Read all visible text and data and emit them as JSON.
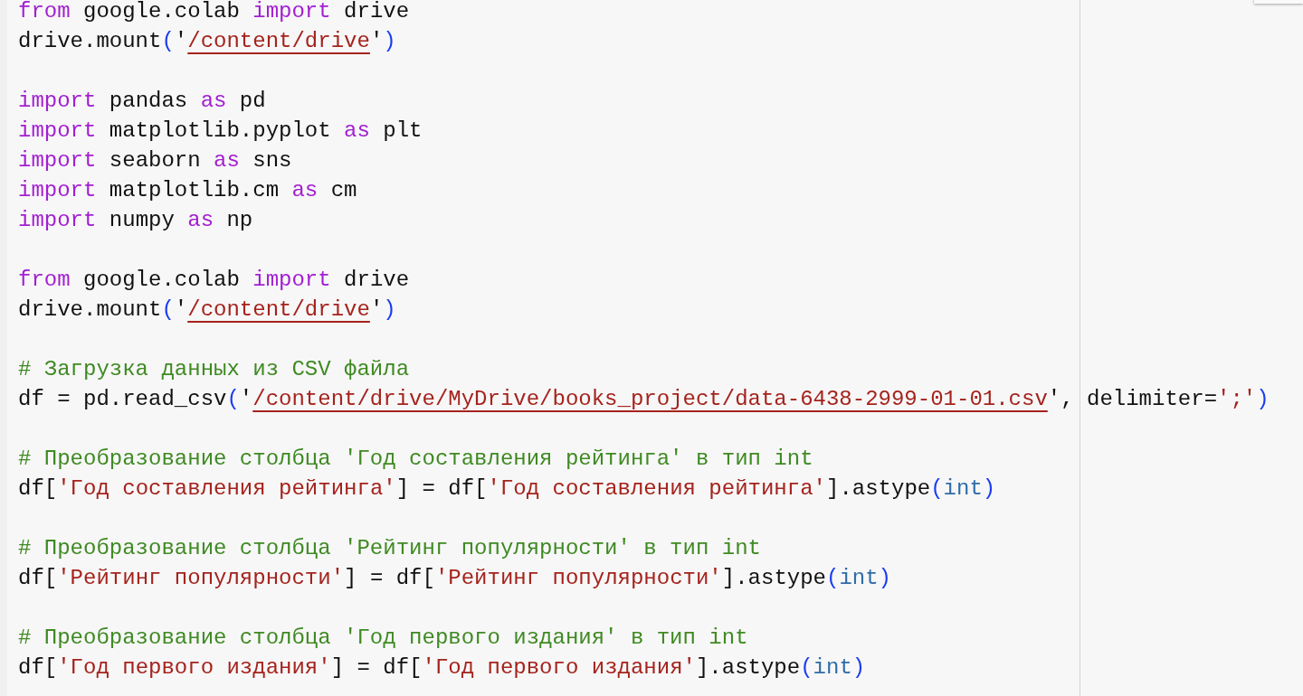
{
  "editor": {
    "blocks": [
      [
        {
          "tokens": [
            {
              "kind": "keyword",
              "text": "from"
            },
            {
              "kind": "plain",
              "text": " google.colab "
            },
            {
              "kind": "keyword",
              "text": "import"
            },
            {
              "kind": "plain",
              "text": " drive"
            }
          ]
        },
        {
          "tokens": [
            {
              "kind": "plain",
              "text": "drive.mount"
            },
            {
              "kind": "paren",
              "text": "("
            },
            {
              "kind": "plain",
              "text": "'"
            },
            {
              "kind": "path",
              "text": "/content/drive"
            },
            {
              "kind": "plain",
              "text": "'"
            },
            {
              "kind": "paren",
              "text": ")"
            }
          ]
        }
      ],
      [
        {
          "tokens": [
            {
              "kind": "keyword",
              "text": "import"
            },
            {
              "kind": "plain",
              "text": " pandas "
            },
            {
              "kind": "keyword",
              "text": "as"
            },
            {
              "kind": "plain",
              "text": " pd"
            }
          ]
        },
        {
          "tokens": [
            {
              "kind": "keyword",
              "text": "import"
            },
            {
              "kind": "plain",
              "text": " matplotlib.pyplot "
            },
            {
              "kind": "keyword",
              "text": "as"
            },
            {
              "kind": "plain",
              "text": " plt"
            }
          ]
        },
        {
          "tokens": [
            {
              "kind": "keyword",
              "text": "import"
            },
            {
              "kind": "plain",
              "text": " seaborn "
            },
            {
              "kind": "keyword",
              "text": "as"
            },
            {
              "kind": "plain",
              "text": " sns"
            }
          ]
        },
        {
          "tokens": [
            {
              "kind": "keyword",
              "text": "import"
            },
            {
              "kind": "plain",
              "text": " matplotlib.cm "
            },
            {
              "kind": "keyword",
              "text": "as"
            },
            {
              "kind": "plain",
              "text": " cm"
            }
          ]
        },
        {
          "tokens": [
            {
              "kind": "keyword",
              "text": "import"
            },
            {
              "kind": "plain",
              "text": " numpy "
            },
            {
              "kind": "keyword",
              "text": "as"
            },
            {
              "kind": "plain",
              "text": " np"
            }
          ]
        }
      ],
      [
        {
          "tokens": [
            {
              "kind": "keyword",
              "text": "from"
            },
            {
              "kind": "plain",
              "text": " google.colab "
            },
            {
              "kind": "keyword",
              "text": "import"
            },
            {
              "kind": "plain",
              "text": " drive"
            }
          ]
        },
        {
          "tokens": [
            {
              "kind": "plain",
              "text": "drive.mount"
            },
            {
              "kind": "paren",
              "text": "("
            },
            {
              "kind": "plain",
              "text": "'"
            },
            {
              "kind": "path",
              "text": "/content/drive"
            },
            {
              "kind": "plain",
              "text": "'"
            },
            {
              "kind": "paren",
              "text": ")"
            }
          ]
        }
      ],
      [
        {
          "tokens": [
            {
              "kind": "comment",
              "text": "# Загрузка данных из CSV файла"
            }
          ]
        },
        {
          "tokens": [
            {
              "kind": "plain",
              "text": "df = pd.read_csv"
            },
            {
              "kind": "paren",
              "text": "("
            },
            {
              "kind": "plain",
              "text": "'"
            },
            {
              "kind": "path",
              "text": "/content/drive/MyDrive/books_project/data-6438-2999-01-01.csv"
            },
            {
              "kind": "plain",
              "text": "'"
            },
            {
              "kind": "plain",
              "text": ", delimiter="
            },
            {
              "kind": "string",
              "text": "';'"
            },
            {
              "kind": "paren",
              "text": ")"
            }
          ]
        }
      ],
      [
        {
          "tokens": [
            {
              "kind": "comment",
              "text": "# Преобразование столбца 'Год составления рейтинга' в тип int"
            }
          ]
        },
        {
          "tokens": [
            {
              "kind": "plain",
              "text": "df["
            },
            {
              "kind": "string",
              "text": "'Год составления рейтинга'"
            },
            {
              "kind": "plain",
              "text": "] = df["
            },
            {
              "kind": "string",
              "text": "'Год составления рейтинга'"
            },
            {
              "kind": "plain",
              "text": "].astype"
            },
            {
              "kind": "paren",
              "text": "("
            },
            {
              "kind": "builtin",
              "text": "int"
            },
            {
              "kind": "paren",
              "text": ")"
            }
          ]
        }
      ],
      [
        {
          "tokens": [
            {
              "kind": "comment",
              "text": "# Преобразование столбца 'Рейтинг популярности' в тип int"
            }
          ]
        },
        {
          "tokens": [
            {
              "kind": "plain",
              "text": "df["
            },
            {
              "kind": "string",
              "text": "'Рейтинг популярности'"
            },
            {
              "kind": "plain",
              "text": "] = df["
            },
            {
              "kind": "string",
              "text": "'Рейтинг популярности'"
            },
            {
              "kind": "plain",
              "text": "].astype"
            },
            {
              "kind": "paren",
              "text": "("
            },
            {
              "kind": "builtin",
              "text": "int"
            },
            {
              "kind": "paren",
              "text": ")"
            }
          ]
        }
      ],
      [
        {
          "tokens": [
            {
              "kind": "comment",
              "text": "# Преобразование столбца 'Год первого издания' в тип int"
            }
          ]
        },
        {
          "tokens": [
            {
              "kind": "plain",
              "text": "df["
            },
            {
              "kind": "string",
              "text": "'Год первого издания'"
            },
            {
              "kind": "plain",
              "text": "] = df["
            },
            {
              "kind": "string",
              "text": "'Год первого издания'"
            },
            {
              "kind": "plain",
              "text": "].astype"
            },
            {
              "kind": "paren",
              "text": "("
            },
            {
              "kind": "builtin",
              "text": "int"
            },
            {
              "kind": "paren",
              "text": ")"
            }
          ]
        }
      ]
    ]
  }
}
